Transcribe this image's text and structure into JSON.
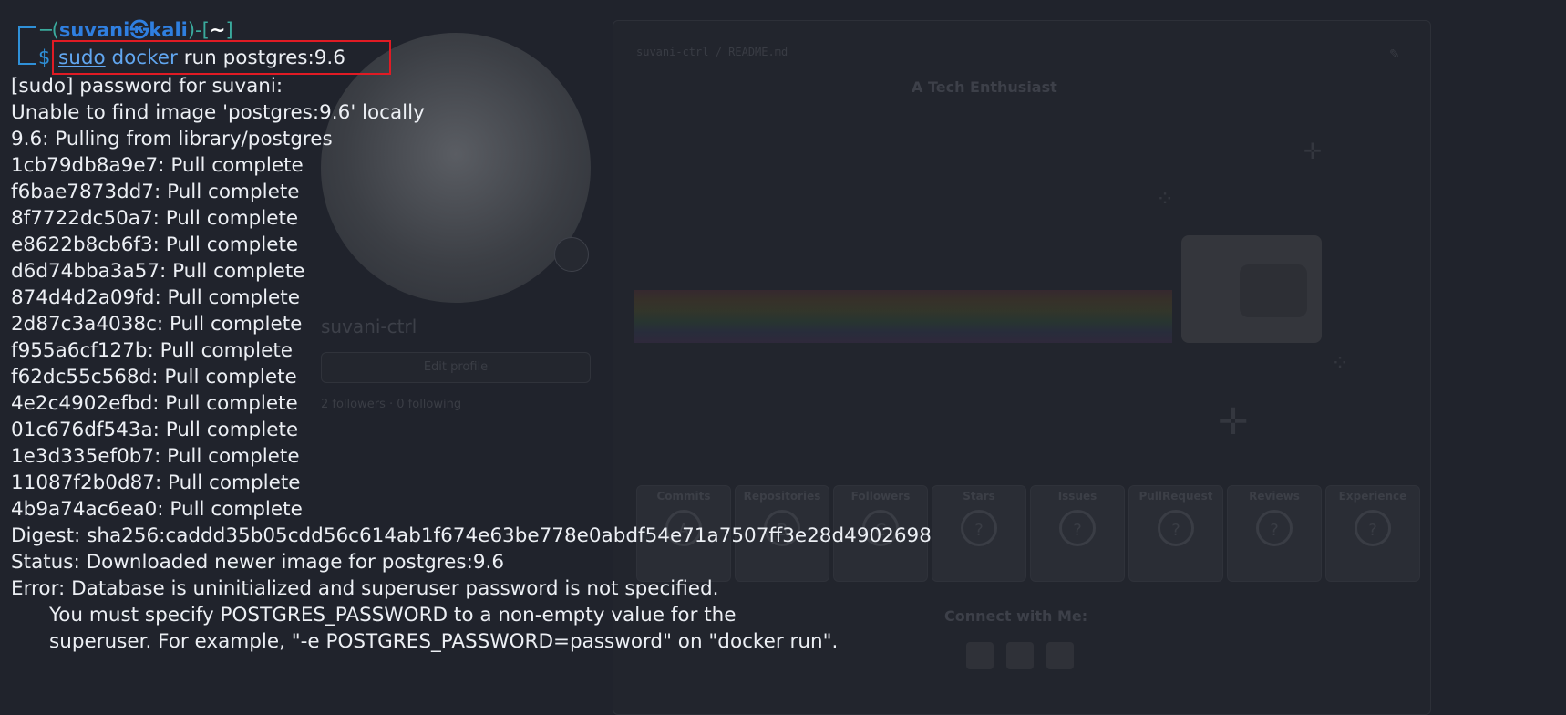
{
  "background_page": {
    "username": "suvani-ctrl",
    "edit_profile_label": "Edit profile",
    "followers_text": "2 followers · 0 following",
    "readme_path": "suvani-ctrl / README.md",
    "readme_title": "A Tech Enthusiast",
    "trophies": [
      "Commits",
      "Repositories",
      "Followers",
      "Stars",
      "Issues",
      "PullRequest",
      "Reviews",
      "Experience"
    ],
    "connect_title": "Connect with Me:"
  },
  "terminal": {
    "prompt": {
      "user": "suvani",
      "at_symbol": "㉿",
      "host": "kali",
      "cwd": "~",
      "dollar": "$"
    },
    "command": {
      "sudo": "sudo",
      "docker": "docker",
      "rest": "run postgres:9.6"
    },
    "output": [
      "[sudo] password for suvani:",
      "Unable to find image 'postgres:9.6' locally",
      "9.6: Pulling from library/postgres",
      "1cb79db8a9e7: Pull complete",
      "f6bae7873dd7: Pull complete",
      "8f7722dc50a7: Pull complete",
      "e8622b8cb6f3: Pull complete",
      "d6d74bba3a57: Pull complete",
      "874d4d2a09fd: Pull complete",
      "2d87c3a4038c: Pull complete",
      "f955a6cf127b: Pull complete",
      "f62dc55c568d: Pull complete",
      "4e2c4902efbd: Pull complete",
      "01c676df543a: Pull complete",
      "1e3d335ef0b7: Pull complete",
      "11087f2b0d87: Pull complete",
      "4b9a74ac6ea0: Pull complete",
      "Digest: sha256:caddd35b05cdd56c614ab1f674e63be778e0abdf54e71a7507ff3e28d4902698",
      "Status: Downloaded newer image for postgres:9.6",
      "Error: Database is uninitialized and superuser password is not specified."
    ],
    "error_detail": [
      "You must specify POSTGRES_PASSWORD to a non-empty value for the",
      "superuser. For example, \"-e POSTGRES_PASSWORD=password\" on \"docker run\"."
    ]
  },
  "colors": {
    "terminal_bg": "#20232c",
    "prompt_blue": "#2f90d8",
    "command_blue": "#61a6f0",
    "highlight_red": "#e01b24"
  }
}
